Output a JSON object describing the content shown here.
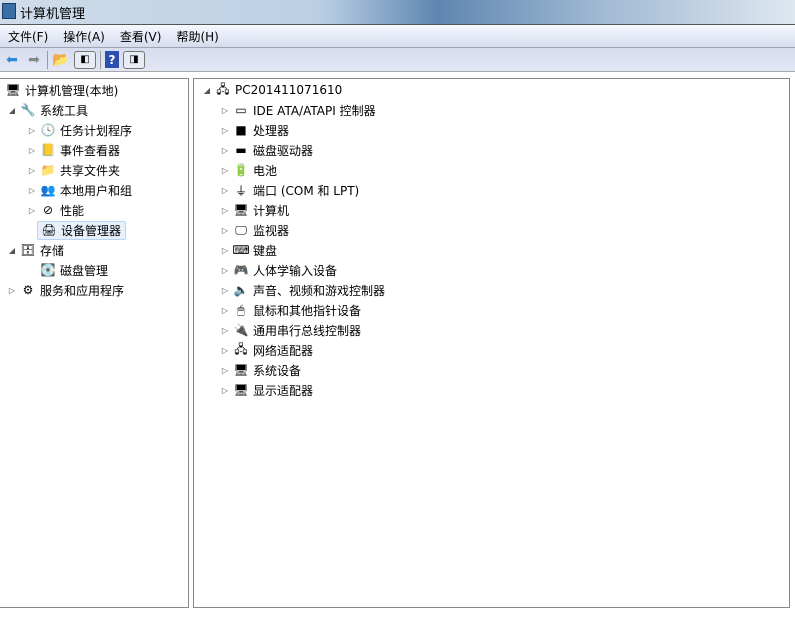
{
  "window": {
    "title": "计算机管理"
  },
  "menu": [
    "文件(F)",
    "操作(A)",
    "查看(V)",
    "帮助(H)"
  ],
  "left_tree": [
    {
      "label": "计算机管理(本地)",
      "level": 0,
      "expander": "",
      "icon": "computer-management-icon",
      "glyph": "🖥"
    },
    {
      "label": "系统工具",
      "level": 1,
      "expander": "◢",
      "icon": "tools-icon",
      "glyph": "🔧"
    },
    {
      "label": "任务计划程序",
      "level": 2,
      "expander": "▷",
      "icon": "clock-icon",
      "glyph": "🕓"
    },
    {
      "label": "事件查看器",
      "level": 2,
      "expander": "▷",
      "icon": "event-viewer-icon",
      "glyph": "📒"
    },
    {
      "label": "共享文件夹",
      "level": 2,
      "expander": "▷",
      "icon": "shared-folder-icon",
      "glyph": "📁"
    },
    {
      "label": "本地用户和组",
      "level": 2,
      "expander": "▷",
      "icon": "users-icon",
      "glyph": "👥"
    },
    {
      "label": "性能",
      "level": 2,
      "expander": "▷",
      "icon": "performance-icon",
      "glyph": "⊘"
    },
    {
      "label": "设备管理器",
      "level": 2,
      "expander": "",
      "icon": "device-manager-icon",
      "glyph": "🖨",
      "selected": true
    },
    {
      "label": "存储",
      "level": 1,
      "expander": "◢",
      "icon": "storage-icon",
      "glyph": "🗄"
    },
    {
      "label": "磁盘管理",
      "level": 2,
      "expander": "",
      "icon": "disk-management-icon",
      "glyph": "💽"
    },
    {
      "label": "服务和应用程序",
      "level": 1,
      "expander": "▷",
      "icon": "services-icon",
      "glyph": "⚙",
      "root": true
    }
  ],
  "right_tree": {
    "root": "PC201411071610",
    "items": [
      {
        "label": "IDE ATA/ATAPI 控制器",
        "icon": "ide-controller-icon",
        "glyph": "▭"
      },
      {
        "label": "处理器",
        "icon": "processor-icon",
        "glyph": "■"
      },
      {
        "label": "磁盘驱动器",
        "icon": "disk-drive-icon",
        "glyph": "▬"
      },
      {
        "label": "电池",
        "icon": "battery-icon",
        "glyph": "🔋"
      },
      {
        "label": "端口 (COM 和 LPT)",
        "icon": "port-icon",
        "glyph": "⏚"
      },
      {
        "label": "计算机",
        "icon": "computer-icon",
        "glyph": "🖥"
      },
      {
        "label": "监视器",
        "icon": "monitor-icon",
        "glyph": "🖵"
      },
      {
        "label": "键盘",
        "icon": "keyboard-icon",
        "glyph": "⌨"
      },
      {
        "label": "人体学输入设备",
        "icon": "hid-icon",
        "glyph": "🎮"
      },
      {
        "label": "声音、视频和游戏控制器",
        "icon": "sound-icon",
        "glyph": "🔈"
      },
      {
        "label": "鼠标和其他指针设备",
        "icon": "mouse-icon",
        "glyph": "🖱"
      },
      {
        "label": "通用串行总线控制器",
        "icon": "usb-icon",
        "glyph": "🔌"
      },
      {
        "label": "网络适配器",
        "icon": "network-adapter-icon",
        "glyph": "🖧"
      },
      {
        "label": "系统设备",
        "icon": "system-device-icon",
        "glyph": "🖥"
      },
      {
        "label": "显示适配器",
        "icon": "display-adapter-icon",
        "glyph": "🖥"
      }
    ]
  }
}
